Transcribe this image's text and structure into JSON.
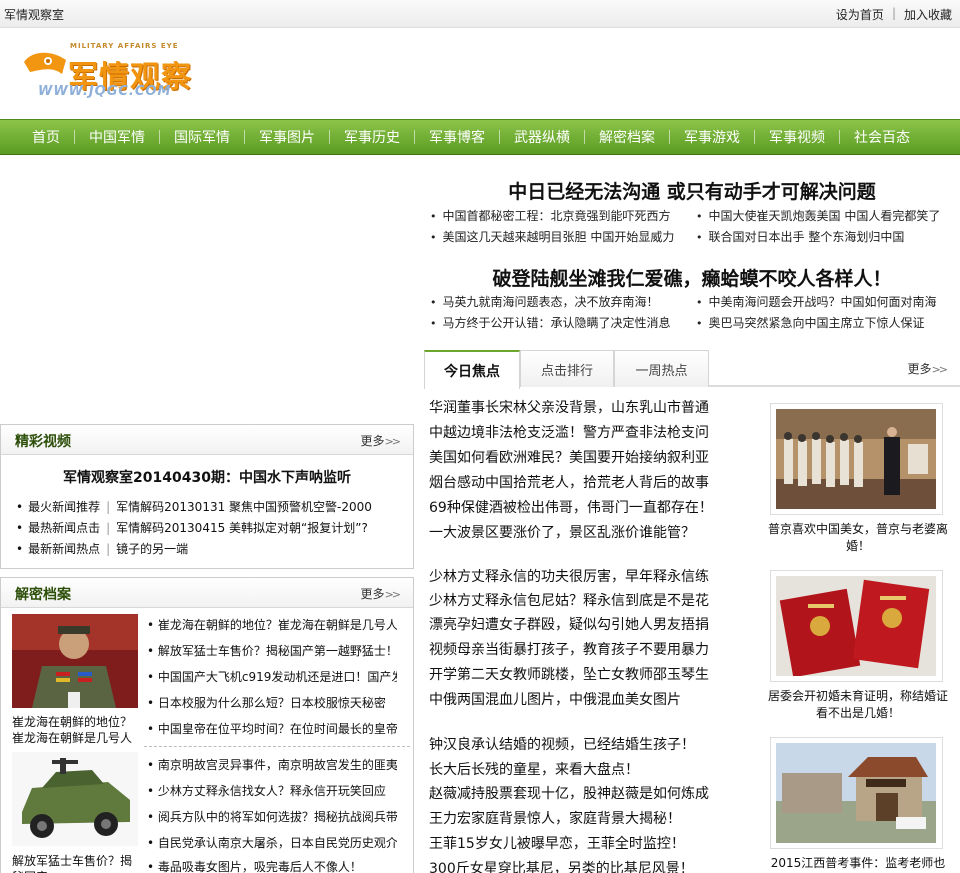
{
  "topbar": {
    "site_name": "军情观察室",
    "set_home": "设为首页",
    "separator": "|",
    "add_favorite": "加入收藏"
  },
  "logo": {
    "en_text": "MILITARY AFFAIRS EYE",
    "cn_text": "军情观察",
    "url_text": "WWW.JQGC.COM"
  },
  "nav": {
    "items": [
      "首页",
      "中国军情",
      "国际军情",
      "军事图片",
      "军事历史",
      "军事博客",
      "武器纵横",
      "解密档案",
      "军事游戏",
      "军事视频",
      "社会百态"
    ]
  },
  "headlines": {
    "main1": "中日已经无法沟通  或只有动手才可解决问题",
    "links1": [
      "中国首都秘密工程：北京竟强到能吓死西方",
      "中国大使崔天凯炮轰美国 中国人看完都笑了",
      "美国这几天越来越明目张胆 中国开始显威力",
      "联合国对日本出手 整个东海划归中国"
    ],
    "main2": "破登陆舰坐滩我仁爱礁，癞蛤蟆不咬人各样人！",
    "links2": [
      "马英九就南海问题表态，决不放弃南海！",
      "中美南海问题会开战吗？中国如何面对南海",
      "马方终于公开认错：承认隐瞒了决定性消息",
      "奥巴马突然紧急向中国主席立下惊人保证"
    ]
  },
  "tabs": {
    "items": [
      "今日焦点",
      "点击排行",
      "一周热点"
    ],
    "more": "更多"
  },
  "news": {
    "group1": [
      "华润董事长宋林父亲没背景，山东乳山市普通",
      "中越边境非法枪支泛滥！警方严查非法枪支问",
      "美国如何看欧洲难民？美国要开始接纳叙利亚",
      "烟台感动中国拾荒老人，拾荒老人背后的故事",
      "69种保健酒被检出伟哥，伟哥门一直都存在！",
      "一大波景区要涨价了，景区乱涨价谁能管？"
    ],
    "group2": [
      "少林方丈释永信的功夫很厉害，早年释永信练",
      "少林方丈释永信包尼姑？释永信到底是不是花",
      "漂亮孕妇遭女子群殴，疑似勾引她人男友捂捐",
      "视频母亲当街暴打孩子，教育孩子不要用暴力",
      "开学第二天女教师跳楼，坠亡女教师邵玉琴生",
      "中俄两国混血儿图片，中俄混血美女图片"
    ],
    "group3": [
      "钟汉良承认结婚的视频，已经结婚生孩子！",
      "长大后长残的童星，来看大盘点！",
      "赵薇减持股票套现十亿，股神赵薇是如何炼成",
      "王力宏家庭背景惊人，家庭背景大揭秘！",
      "王菲15岁女儿被曝早恋，王菲全时监控！",
      "300斤女星穿比基尼，另类的比基尼风景！"
    ]
  },
  "thumbs": [
    {
      "caption": "普京喜欢中国美女，普京与老婆离婚！"
    },
    {
      "caption": "居委会开初婚未育证明，称结婚证看不出是几婚！"
    },
    {
      "caption": "2015江西普考事件：监考老师也"
    }
  ],
  "video_box": {
    "title": "精彩视频",
    "more": "更多",
    "headline": "军情观察室20140430期：中国水下声呐监听",
    "rows": [
      {
        "tag": "最火新闻推荐",
        "link": "军情解码20130131 聚焦中国预警机空警-2000"
      },
      {
        "tag": "最热新闻点击",
        "link": "军情解码20130415 美韩拟定对朝“报复计划”?"
      },
      {
        "tag": "最新新闻热点",
        "link": "镜子的另一端"
      }
    ]
  },
  "archive_box": {
    "title": "解密档案",
    "more": "更多",
    "caption1": "崔龙海在朝鲜的地位？崔龙海在朝鲜是几号人",
    "caption2": "解放军猛士车售价？揭秘国产",
    "links1": [
      "崔龙海在朝鲜的地位？崔龙海在朝鲜是几号人",
      "解放军猛士车售价？揭秘国产第一越野猛士！",
      "中国国产大飞机c919发动机还是进口！国产发",
      "日本校服为什么那么短？日本校服惊天秘密",
      "中国皇帝在位平均时间？在位时间最长的皇帝"
    ],
    "links2": [
      "南京明故宫灵异事件，南京明故宫发生的匪夷",
      "少林方丈释永信找女人？释永信开玩笑回应",
      "阅兵方队中的将军如何选拔？揭秘抗战阅兵带",
      "自民党承认南京大屠杀，日本自民党历史观介",
      "毒品吸毒女图片，吸完毒后人不像人！"
    ]
  },
  "colors": {
    "nav_green": "#6aa52c",
    "logo_orange": "#f29611",
    "box_title_green": "#2d4f0a"
  }
}
